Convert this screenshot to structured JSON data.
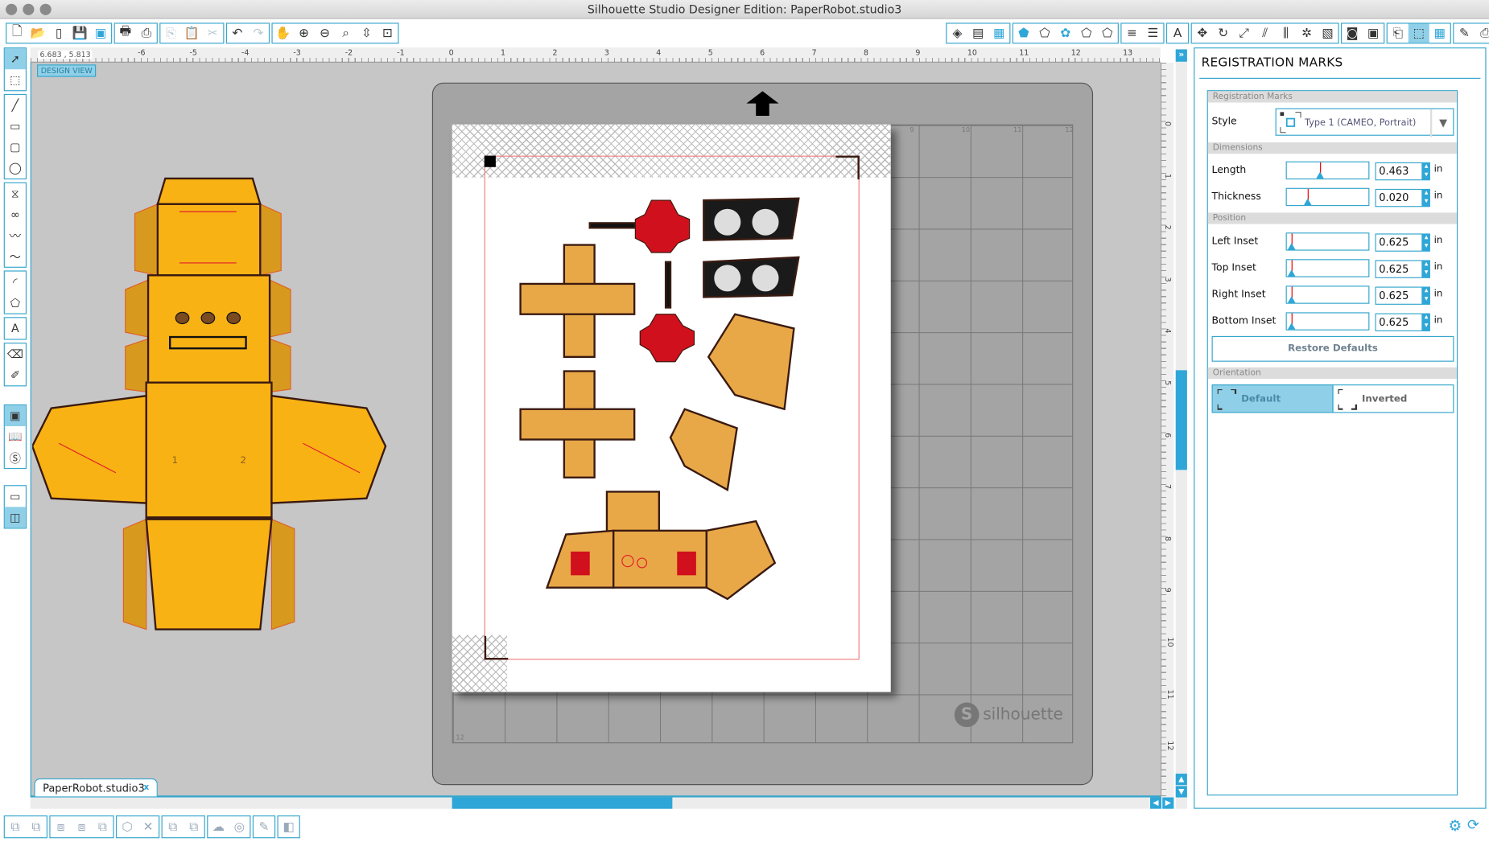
{
  "window": {
    "title": "Silhouette Studio Designer Edition: PaperRobot.studio3"
  },
  "toolbar_left": [
    [
      "new-document",
      "🗋",
      ""
    ],
    [
      "open-folder",
      "📂",
      ""
    ],
    [
      "open-library",
      "▯",
      ""
    ],
    [
      "save",
      "💾",
      ""
    ],
    [
      "save-to-sd",
      "▣",
      "blue"
    ],
    null,
    [
      "print",
      "🖶",
      ""
    ],
    [
      "print-and-cut",
      "⎙",
      ""
    ],
    null,
    [
      "copy",
      "⎘",
      "dim"
    ],
    [
      "paste",
      "📋",
      ""
    ],
    [
      "cut",
      "✂",
      "dim"
    ],
    null,
    [
      "undo",
      "↶",
      ""
    ],
    [
      "redo",
      "↷",
      "dim"
    ],
    null,
    [
      "pan-hand",
      "✋",
      ""
    ],
    [
      "zoom-in",
      "⊕",
      ""
    ],
    [
      "zoom-out",
      "⊖",
      ""
    ],
    [
      "zoom-select",
      "⌕",
      ""
    ],
    [
      "drag-zoom",
      "⇳",
      ""
    ],
    [
      "fit-to-page",
      "⊡",
      ""
    ]
  ],
  "toolbar_right": [
    [
      "fill-color",
      "◈",
      ""
    ],
    [
      "gradient-fill",
      "▤",
      ""
    ],
    [
      "pattern-fill",
      "▦",
      "blue"
    ],
    null,
    [
      "line-color",
      "⬟",
      "blue"
    ],
    [
      "line-style",
      "⬠",
      ""
    ],
    [
      "offset",
      "✿",
      "blue"
    ],
    [
      "trace",
      "⬠",
      ""
    ],
    [
      "sketch",
      "⬠",
      ""
    ],
    null,
    [
      "line-color-lines",
      "≡",
      ""
    ],
    [
      "line-thickness",
      "☰",
      ""
    ],
    null,
    [
      "text-style",
      "A",
      ""
    ],
    null,
    [
      "transform",
      "✥",
      ""
    ],
    [
      "rotate",
      "↻",
      ""
    ],
    [
      "scale",
      "⤢",
      ""
    ],
    [
      "shear",
      "⫽",
      ""
    ],
    [
      "align",
      "⫼",
      ""
    ],
    [
      "replicate",
      "✲",
      ""
    ],
    [
      "modify",
      "▧",
      ""
    ],
    null,
    [
      "media-library",
      "◙",
      ""
    ],
    [
      "cut-settings",
      "▣",
      ""
    ],
    null,
    [
      "page-setup",
      "⎗",
      ""
    ],
    [
      "registration-marks",
      "⬚",
      "on"
    ],
    [
      "grid",
      "▦",
      "blue"
    ],
    null,
    [
      "send-to-silhouette",
      "✎",
      ""
    ],
    [
      "cut-send",
      "⎙",
      ""
    ]
  ],
  "left_tools": [
    [
      [
        "select",
        "➚",
        "on"
      ],
      [
        "point-edit",
        "⬚",
        ""
      ]
    ],
    [
      [
        "line",
        "╱",
        ""
      ],
      [
        "rectangle",
        "▭",
        ""
      ],
      [
        "rounded-rectangle",
        "▢",
        ""
      ],
      [
        "ellipse",
        "◯",
        ""
      ]
    ],
    [
      [
        "polygon",
        "⧖",
        ""
      ],
      [
        "curve",
        "∞",
        ""
      ],
      [
        "freehand",
        "〰",
        ""
      ],
      [
        "smooth-freehand",
        "〜",
        ""
      ]
    ],
    [
      [
        "arc",
        "◜",
        ""
      ],
      [
        "regular-polygon",
        "⬠",
        ""
      ]
    ],
    [
      [
        "text",
        "A",
        ""
      ]
    ],
    [
      [
        "eraser",
        "⌫",
        ""
      ],
      [
        "knife",
        "✐",
        ""
      ]
    ],
    [
      [
        "design-view",
        "▣",
        "on"
      ],
      [
        "library",
        "📖",
        ""
      ],
      [
        "silhouette-store",
        "Ⓢ",
        ""
      ]
    ],
    [
      [
        "single-panel",
        "▭",
        ""
      ],
      [
        "split-panel",
        "◫",
        "on"
      ]
    ]
  ],
  "bottom_tools": [
    [
      "group",
      "⧉"
    ],
    [
      "ungroup",
      "⧉"
    ],
    null,
    [
      "make-compound-path",
      "⧈"
    ],
    [
      "release-compound-path",
      "⧈"
    ],
    [
      "bring-forward",
      "⧉"
    ],
    null,
    [
      "weld",
      "⬡"
    ],
    [
      "delete",
      "✕"
    ],
    null,
    [
      "send-backward",
      "⧉"
    ],
    [
      "send-to-back",
      "⧉"
    ],
    null,
    [
      "offset-shape",
      "☁"
    ],
    [
      "trace-target",
      "◎"
    ],
    null,
    [
      "knife-tool",
      "✎"
    ],
    null,
    [
      "layer",
      "◧"
    ]
  ],
  "ruler": {
    "coord": "6.683 , 5.813",
    "h_labels": [
      "-6",
      "-5",
      "-4",
      "-3",
      "-2",
      "-1",
      "0",
      "1",
      "2",
      "3",
      "4",
      "5",
      "6",
      "7",
      "8",
      "9",
      "10",
      "11",
      "12",
      "13"
    ],
    "v_labels": [
      "0",
      "1",
      "2",
      "3",
      "4",
      "5",
      "6",
      "7",
      "8",
      "9",
      "10",
      "11",
      "12"
    ]
  },
  "canvas": {
    "design_view": "DESIGN VIEW",
    "mat_labels": [
      "9",
      "10",
      "11",
      "12"
    ],
    "mat_bottom_label": "12",
    "brand": "silhouette",
    "brand_mark": "S"
  },
  "document_tab": {
    "label": "PaperRobot.studio3",
    "close": "x"
  },
  "panel": {
    "title": "REGISTRATION MARKS",
    "sections": {
      "marks": "Registration Marks",
      "dimensions": "Dimensions",
      "position": "Position",
      "orientation": "Orientation"
    },
    "style": {
      "label": "Style",
      "value": "Type 1 (CAMEO, Portrait)"
    },
    "fields": [
      {
        "label": "Length",
        "value": "0.463",
        "unit": "in",
        "slider": 0.4
      },
      {
        "label": "Thickness",
        "value": "0.020",
        "unit": "in",
        "slider": 0.25
      },
      {
        "label": "Left Inset",
        "value": "0.625",
        "unit": "in",
        "slider": 0.06
      },
      {
        "label": "Top Inset",
        "value": "0.625",
        "unit": "in",
        "slider": 0.06
      },
      {
        "label": "Right Inset",
        "value": "0.625",
        "unit": "in",
        "slider": 0.06
      },
      {
        "label": "Bottom Inset",
        "value": "0.625",
        "unit": "in",
        "slider": 0.06
      }
    ],
    "restore": "Restore Defaults",
    "orientation": {
      "default": "Default",
      "inverted": "Inverted",
      "selected": "Default"
    }
  },
  "colors": {
    "accent": "#2ea6d8",
    "robot_body": "#f9b214",
    "robot_flap": "#d89a1e",
    "print_orange": "#e9a848",
    "red_part": "#d0101c",
    "mat": "#a4a4a4",
    "canvas": "#c6c6c6"
  }
}
